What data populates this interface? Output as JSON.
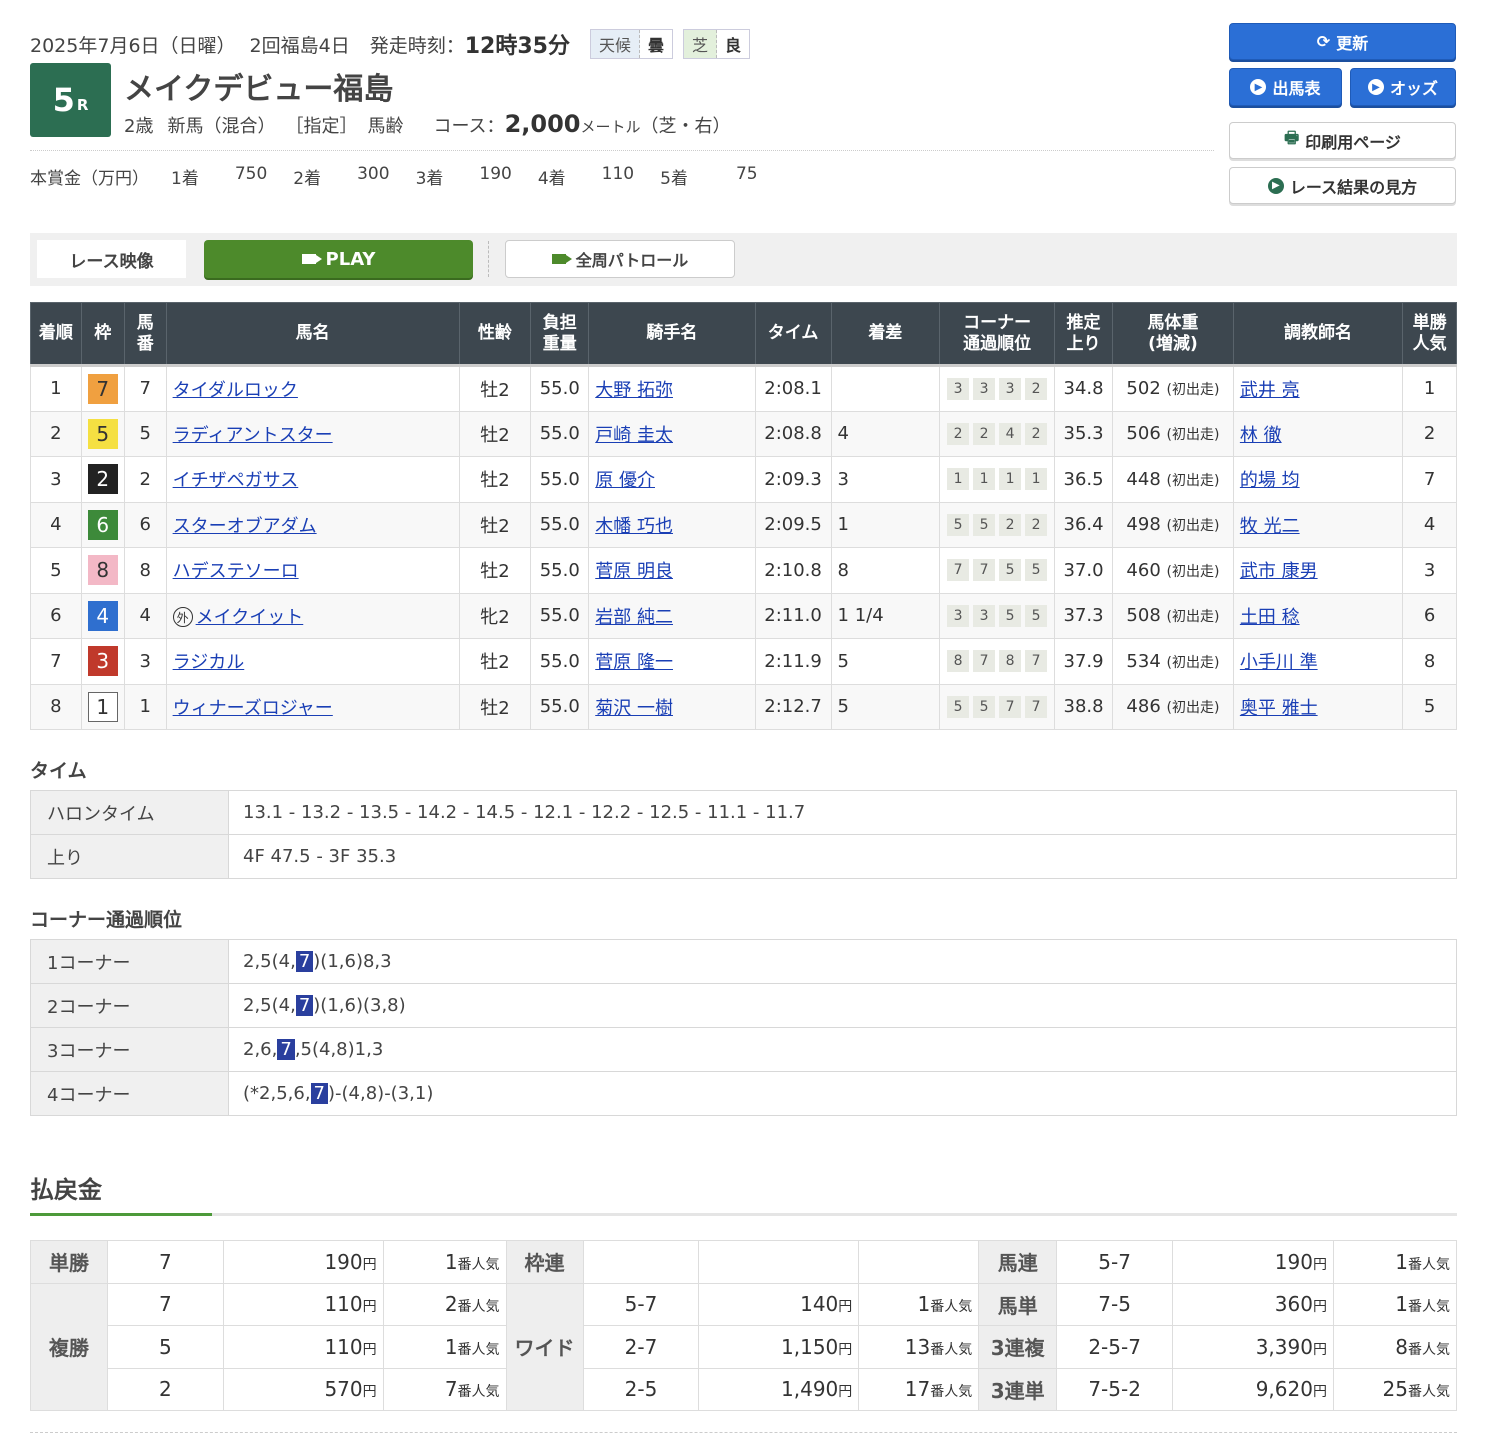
{
  "header": {
    "date_text": "2025年7月6日（日曜）",
    "kaisai": "2回福島4日",
    "start_label": "発走時刻：",
    "start_time": "12時35分",
    "weather_label": "天候",
    "weather_value": "曇",
    "track_label": "芝",
    "track_value": "良",
    "race_number": "5",
    "race_r": "R",
    "race_name": "メイクデビュー福島",
    "cond_age": "2歳",
    "cond_class": "新馬（混合）",
    "cond_spec": "［指定］",
    "cond_weight": "馬齢",
    "course_label": "コース：",
    "course_distance": "2,000",
    "course_unit": "メートル",
    "course_detail": "（芝・右）",
    "prize_label": "本賞金（万円）",
    "prizes": [
      {
        "place": "1着",
        "amount": "750"
      },
      {
        "place": "2着",
        "amount": "300"
      },
      {
        "place": "3着",
        "amount": "190"
      },
      {
        "place": "4着",
        "amount": "110"
      },
      {
        "place": "5着",
        "amount": "75"
      }
    ]
  },
  "buttons": {
    "refresh": "更新",
    "entries": "出馬表",
    "odds": "オッズ",
    "print": "印刷用ページ",
    "guide": "レース結果の見方"
  },
  "video": {
    "label": "レース映像",
    "play": "PLAY",
    "patrol": "全周パトロール"
  },
  "results": {
    "headers": {
      "rank": "着順",
      "waku": "枠",
      "umaban_1": "馬",
      "umaban_2": "番",
      "name": "馬名",
      "sexage": "性齢",
      "burden_1": "負担",
      "burden_2": "重量",
      "jockey": "騎手名",
      "time": "タイム",
      "margin": "着差",
      "corner_1": "コーナー",
      "corner_2": "通過順位",
      "last_1": "推定",
      "last_2": "上り",
      "weight_1": "馬体重",
      "weight_2": "(増減)",
      "trainer": "調教師名",
      "pop_1": "単勝",
      "pop_2": "人気"
    },
    "rows": [
      {
        "rank": "1",
        "waku": "7",
        "waku_bg": "#f0a040",
        "waku_fg": "#333",
        "umaban": "7",
        "mark": "",
        "name": "タイダルロック",
        "sexage": "牡2",
        "burden": "55.0",
        "jockey": "大野 拓弥",
        "time": "2:08.1",
        "margin": "",
        "corners": [
          "3",
          "3",
          "3",
          "2"
        ],
        "last": "34.8",
        "weight": "502",
        "weight_diff": "(初出走)",
        "trainer": "武井 亮",
        "pop": "1"
      },
      {
        "rank": "2",
        "waku": "5",
        "waku_bg": "#f5e042",
        "waku_fg": "#333",
        "umaban": "5",
        "mark": "",
        "name": "ラディアントスター",
        "sexage": "牡2",
        "burden": "55.0",
        "jockey": "戸崎 圭太",
        "time": "2:08.8",
        "margin": "4",
        "corners": [
          "2",
          "2",
          "4",
          "2"
        ],
        "last": "35.3",
        "weight": "506",
        "weight_diff": "(初出走)",
        "trainer": "林 徹",
        "pop": "2"
      },
      {
        "rank": "3",
        "waku": "2",
        "waku_bg": "#222222",
        "waku_fg": "#fff",
        "umaban": "2",
        "mark": "",
        "name": "イチザペガサス",
        "sexage": "牡2",
        "burden": "55.0",
        "jockey": "原 優介",
        "time": "2:09.3",
        "margin": "3",
        "corners": [
          "1",
          "1",
          "1",
          "1"
        ],
        "last": "36.5",
        "weight": "448",
        "weight_diff": "(初出走)",
        "trainer": "的場 均",
        "pop": "7"
      },
      {
        "rank": "4",
        "waku": "6",
        "waku_bg": "#3d8a3a",
        "waku_fg": "#fff",
        "umaban": "6",
        "mark": "",
        "name": "スターオブアダム",
        "sexage": "牡2",
        "burden": "55.0",
        "jockey": "木幡 巧也",
        "time": "2:09.5",
        "margin": "1",
        "corners": [
          "5",
          "5",
          "2",
          "2"
        ],
        "last": "36.4",
        "weight": "498",
        "weight_diff": "(初出走)",
        "trainer": "牧 光二",
        "pop": "4"
      },
      {
        "rank": "5",
        "waku": "8",
        "waku_bg": "#f3b8c6",
        "waku_fg": "#333",
        "umaban": "8",
        "mark": "",
        "name": "ハデステソーロ",
        "sexage": "牡2",
        "burden": "55.0",
        "jockey": "菅原 明良",
        "time": "2:10.8",
        "margin": "8",
        "corners": [
          "7",
          "7",
          "5",
          "5"
        ],
        "last": "37.0",
        "weight": "460",
        "weight_diff": "(初出走)",
        "trainer": "武市 康男",
        "pop": "3"
      },
      {
        "rank": "6",
        "waku": "4",
        "waku_bg": "#2f6fcf",
        "waku_fg": "#fff",
        "umaban": "4",
        "mark": "外",
        "name": "メイクイット",
        "sexage": "牝2",
        "burden": "55.0",
        "jockey": "岩部 純二",
        "time": "2:11.0",
        "margin": "1 1/4",
        "corners": [
          "3",
          "3",
          "5",
          "5"
        ],
        "last": "37.3",
        "weight": "508",
        "weight_diff": "(初出走)",
        "trainer": "土田 稔",
        "pop": "6"
      },
      {
        "rank": "7",
        "waku": "3",
        "waku_bg": "#c0392b",
        "waku_fg": "#fff",
        "umaban": "3",
        "mark": "",
        "name": "ラジカル",
        "sexage": "牡2",
        "burden": "55.0",
        "jockey": "菅原 隆一",
        "time": "2:11.9",
        "margin": "5",
        "corners": [
          "8",
          "7",
          "8",
          "7"
        ],
        "last": "37.9",
        "weight": "534",
        "weight_diff": "(初出走)",
        "trainer": "小手川 準",
        "pop": "8"
      },
      {
        "rank": "8",
        "waku": "1",
        "waku_bg": "#ffffff",
        "waku_fg": "#333",
        "umaban": "1",
        "mark": "",
        "name": "ウィナーズロジャー",
        "sexage": "牡2",
        "burden": "55.0",
        "jockey": "菊沢 一樹",
        "time": "2:12.7",
        "margin": "5",
        "corners": [
          "5",
          "5",
          "7",
          "7"
        ],
        "last": "38.8",
        "weight": "486",
        "weight_diff": "(初出走)",
        "trainer": "奥平 雅士",
        "pop": "5"
      }
    ]
  },
  "time_section": {
    "title": "タイム",
    "rows": [
      {
        "label": "ハロンタイム",
        "value": "13.1 - 13.2 - 13.5 - 14.2 - 14.5 - 12.1 - 12.2 - 12.5 - 11.1 - 11.7"
      },
      {
        "label": "上り",
        "value": "4F 47.5 - 3F 35.3"
      }
    ]
  },
  "corner_section": {
    "title": "コーナー通過順位",
    "highlight": "7",
    "rows": [
      {
        "label": "1コーナー",
        "pre": "2,5(4,",
        "post": ")(1,6)8,3"
      },
      {
        "label": "2コーナー",
        "pre": "2,5(4,",
        "post": ")(1,6)(3,8)"
      },
      {
        "label": "3コーナー",
        "pre": "2,6,",
        "post": ",5(4,8)1,3"
      },
      {
        "label": "4コーナー",
        "pre": "(*2,5,6,",
        "post": ")-(4,8)-(3,1)"
      }
    ]
  },
  "payout": {
    "title": "払戻金",
    "yen": "円",
    "pop_suffix": "番人気",
    "tansho": {
      "label": "単勝",
      "rows": [
        {
          "num": "7",
          "pay": "190",
          "pop": "1"
        }
      ]
    },
    "fukusho": {
      "label": "複勝",
      "rows": [
        {
          "num": "7",
          "pay": "110",
          "pop": "2"
        },
        {
          "num": "5",
          "pay": "110",
          "pop": "1"
        },
        {
          "num": "2",
          "pay": "570",
          "pop": "7"
        }
      ]
    },
    "wakuren": {
      "label": "枠連"
    },
    "wide": {
      "label": "ワイド",
      "rows": [
        {
          "num": "5-7",
          "pay": "140",
          "pop": "1"
        },
        {
          "num": "2-7",
          "pay": "1,150",
          "pop": "13"
        },
        {
          "num": "2-5",
          "pay": "1,490",
          "pop": "17"
        }
      ]
    },
    "right": [
      {
        "label": "馬連",
        "num": "5-7",
        "pay": "190",
        "pop": "1"
      },
      {
        "label": "馬単",
        "num": "7-5",
        "pay": "360",
        "pop": "1"
      },
      {
        "label": "3連複",
        "num": "2-5-7",
        "pay": "3,390",
        "pop": "8"
      },
      {
        "label": "3連単",
        "num": "7-5-2",
        "pay": "9,620",
        "pop": "25"
      }
    ]
  }
}
